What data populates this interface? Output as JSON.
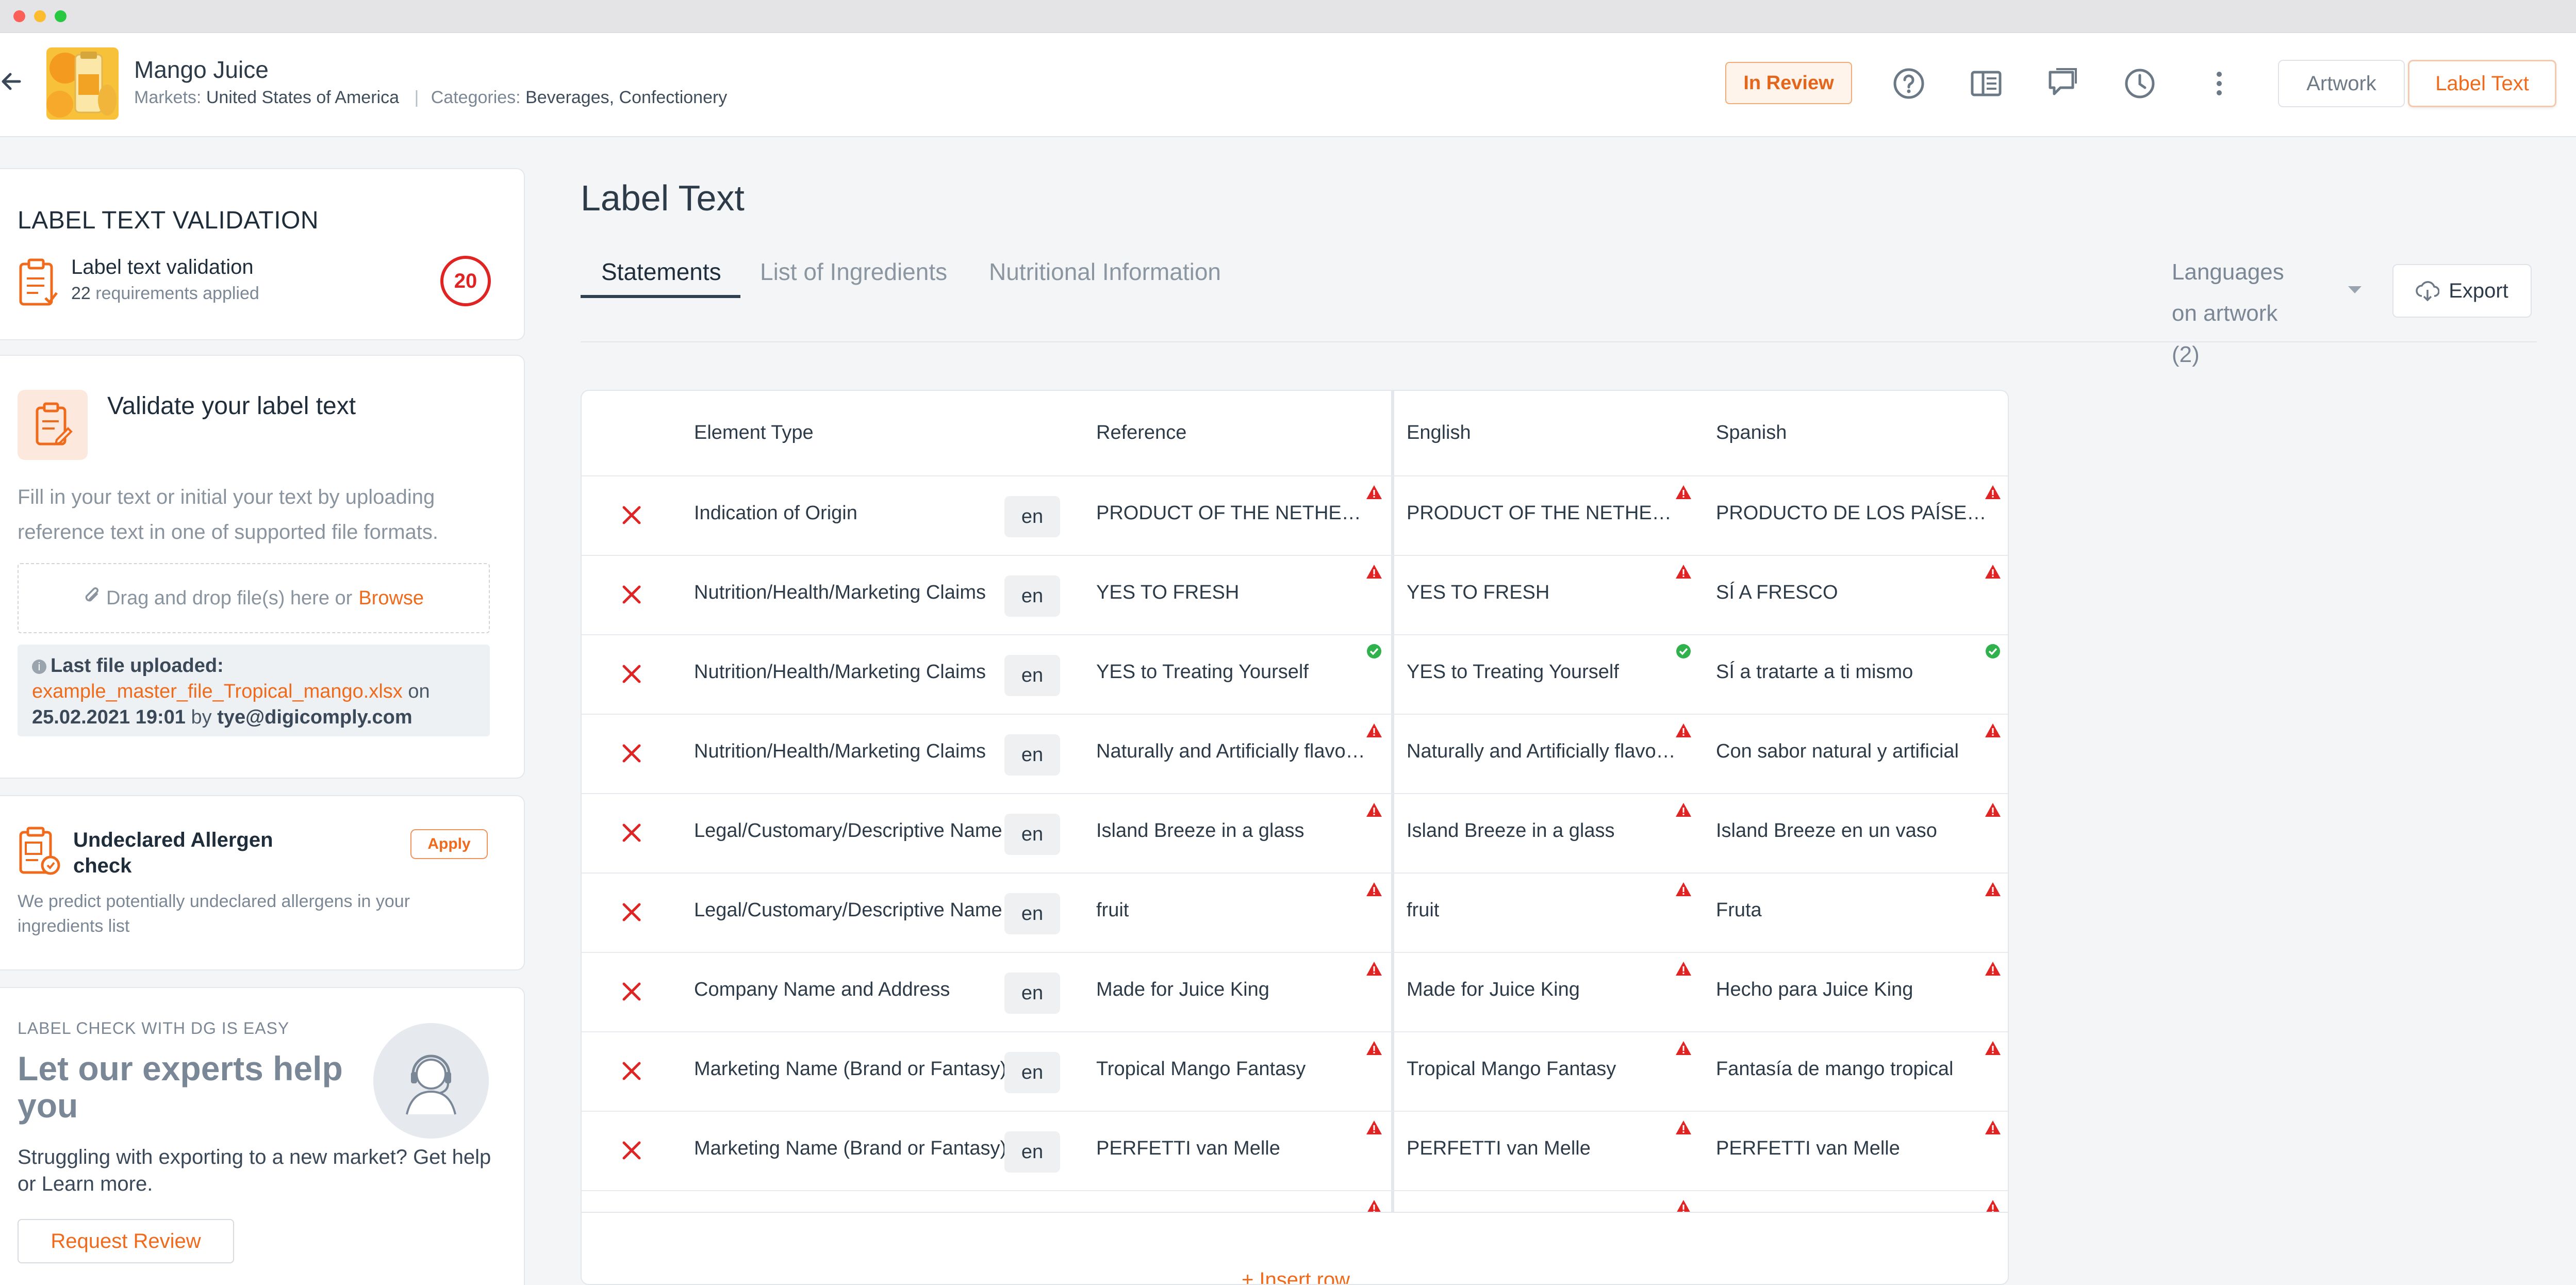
{
  "header": {
    "product_name": "Mango Juice",
    "markets_label": "Markets:",
    "markets_value": "United States of America",
    "categories_label": "Categories:",
    "categories_value": "Beverages, Confectionery",
    "status": "In Review",
    "icons": [
      "back-arrow-icon",
      "help-icon",
      "sidebar-panel-icon",
      "comments-icon",
      "history-icon",
      "more-icon"
    ],
    "view_toggle": {
      "artwork": "Artwork",
      "label_text": "Label Text",
      "selected": "Label Text"
    }
  },
  "sidebar": {
    "label_text_validation": {
      "title": "LABEL TEXT VALIDATION",
      "item_label": "Label text validation",
      "requirements_count": "22",
      "requirements_suffix": " requirements applied",
      "score": "20"
    },
    "validate": {
      "title": "Validate your label text",
      "description": "Fill in your text or initial your text by uploading reference text in one of supported file formats.",
      "dropzone_text": "Drag and drop file(s) here or",
      "browse": "Browse",
      "last_file_label": "Last file uploaded:",
      "last_file_name": "example_master_file_Tropical_mango.xlsx",
      "on": "on",
      "date": "25.02.2021 19:01",
      "by": "by",
      "user": "tye@digicomply.com"
    },
    "allergen": {
      "title": "Undeclared Allergen check",
      "apply": "Apply",
      "description": "We predict potentially undeclared allergens in your ingredients list"
    },
    "experts": {
      "kicker": "LABEL CHECK WITH DG IS EASY",
      "title": "Let our experts help you",
      "description": "Struggling with exporting to a new market? Get help or Learn more.",
      "request_button": "Request Review"
    }
  },
  "main": {
    "title": "Label Text",
    "tabs": [
      "Statements",
      "List of Ingredients",
      "Nutritional Information"
    ],
    "active_tab": "Statements",
    "languages_select": "Languages on artwork (2)",
    "export": "Export",
    "table": {
      "headers": {
        "element_type": "Element Type",
        "reference": "Reference",
        "english": "English",
        "spanish": "Spanish"
      },
      "rows": [
        {
          "element_type": "Indication of Origin",
          "lang": "en",
          "reference": "PRODUCT OF THE NETHERLANDS",
          "english": "PRODUCT OF THE NETHERLANDS",
          "spanish": "PRODUCTO DE LOS PAÍSES BAJOS",
          "status": "warning"
        },
        {
          "element_type": "Nutrition/Health/Marketing Claims",
          "lang": "en",
          "reference": "YES TO FRESH",
          "english": "YES TO FRESH",
          "spanish": "SÍ A FRESCO",
          "status": "warning"
        },
        {
          "element_type": "Nutrition/Health/Marketing Claims",
          "lang": "en",
          "reference": "YES to Treating Yourself",
          "english": "YES to Treating Yourself",
          "spanish": "SÍ a tratarte a ti mismo",
          "status": "ok"
        },
        {
          "element_type": "Nutrition/Health/Marketing Claims",
          "lang": "en",
          "reference": "Naturally and Artificially flavored",
          "english": "Naturally and Artificially flavored",
          "spanish": "Con sabor natural y artificial",
          "status": "warning"
        },
        {
          "element_type": "Legal/Customary/Descriptive Name",
          "lang": "en",
          "reference": "Island Breeze in a glass",
          "english": "Island Breeze in a glass",
          "spanish": "Island Breeze en un vaso",
          "status": "warning"
        },
        {
          "element_type": "Legal/Customary/Descriptive Name",
          "lang": "en",
          "reference": "fruit",
          "english": "fruit",
          "spanish": "Fruta",
          "status": "warning"
        },
        {
          "element_type": "Company Name and Address",
          "lang": "en",
          "reference": "Made for Juice King",
          "english": "Made for Juice King",
          "spanish": "Hecho para Juice King",
          "status": "warning"
        },
        {
          "element_type": "Marketing Name (Brand or Fantasy)",
          "lang": "en",
          "reference": "Tropical Mango Fantasy",
          "english": "Tropical Mango Fantasy",
          "spanish": "Fantasía de mango tropical",
          "status": "warning"
        },
        {
          "element_type": "Marketing Name (Brand or Fantasy)",
          "lang": "en",
          "reference": "PERFETTI van Melle",
          "english": "PERFETTI van Melle",
          "spanish": "PERFETTI van Melle",
          "status": "warning"
        }
      ],
      "insert_row": "+ Insert row"
    }
  },
  "colors": {
    "accent": "#f06a1c",
    "danger": "#e02424",
    "success": "#2fb24c"
  }
}
